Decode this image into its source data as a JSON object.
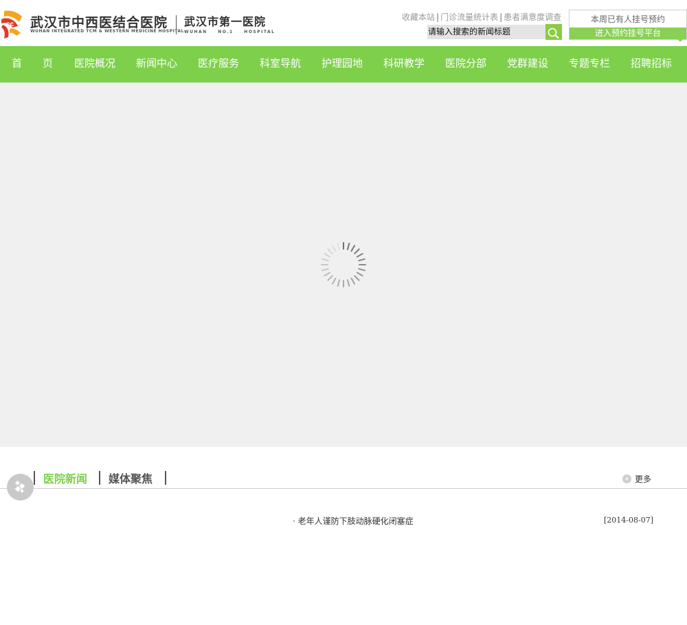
{
  "header": {
    "logo_cn": "武汉市中西医结合医院",
    "logo_en": "WUHAN INTEGRATED TCM & WESTERN MEDICINE HOSPITAL",
    "logo2_cn": "武汉市第一医院",
    "logo2_en": "WUHAN NO.1 HOSPITAL",
    "top_links": [
      "收藏本站",
      "门诊流量统计表",
      "患者满意度调查"
    ],
    "search": {
      "value": "请输入搜索的新闻标题"
    },
    "booking": {
      "count_text": "本周已有人挂号预约",
      "link_label": "进入预约挂号平台"
    }
  },
  "nav": {
    "items": [
      "首　　页",
      "医院概况",
      "新闻中心",
      "医疗服务",
      "科室导航",
      "护理园地",
      "科研教学",
      "医院分部",
      "党群建设",
      "专题专栏",
      "招聘招标"
    ]
  },
  "news": {
    "tabs": [
      "医院新闻",
      "媒体聚焦"
    ],
    "more_label": "更多",
    "items": [
      {
        "title": "· 老年人谨防下肢动脉硬化闭塞症",
        "date": "[2014-08-07]"
      }
    ]
  },
  "colors": {
    "accent_green": "#7ed04b",
    "banner_bg": "#f0f0f0",
    "logo_red": "#e03a2a",
    "logo_orange": "#f5a51c"
  },
  "icons": [
    "logo-mark-icon",
    "search-icon",
    "loading-spinner-icon",
    "plus-circle-icon",
    "float-widget-icon",
    "dropdown-arrow-icon"
  ]
}
